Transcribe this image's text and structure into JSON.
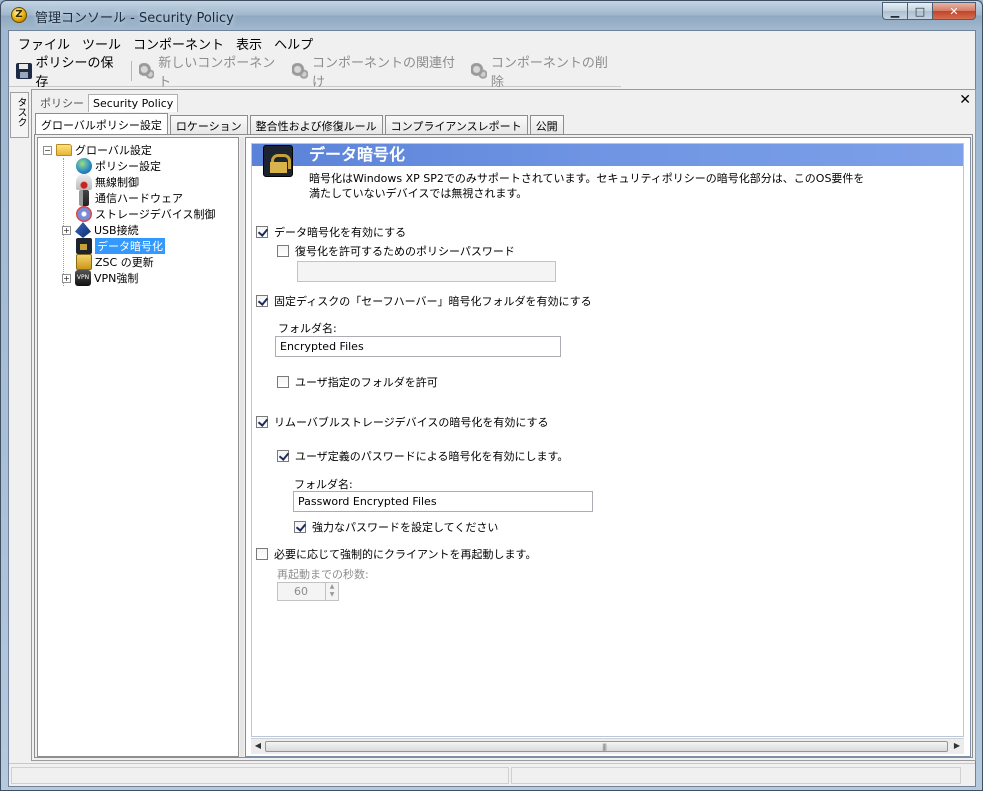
{
  "window": {
    "title": "管理コンソール - Security Policy"
  },
  "menu": [
    "ファイル",
    "ツール",
    "コンポーネント",
    "表示",
    "ヘルプ"
  ],
  "toolbar": {
    "save": "ポリシーの保存",
    "new_component": "新しいコンポーネント",
    "associate_component": "コンポーネントの関連付け",
    "delete_component": "コンポーネントの削除"
  },
  "task_strip": "タスク",
  "document": {
    "label": "ポリシー",
    "tab": "Security Policy"
  },
  "tabs": [
    "グローバルポリシー設定",
    "ロケーション",
    "整合性および修復ルール",
    "コンプライアンスレポート",
    "公開"
  ],
  "tree": {
    "root": "グローバル設定",
    "items": [
      "ポリシー設定",
      "無線制御",
      "通信ハードウェア",
      "ストレージデバイス制御",
      "USB接続",
      "データ暗号化",
      "ZSC の更新",
      "VPN強制"
    ],
    "selected": "データ暗号化"
  },
  "content": {
    "title": "データ暗号化",
    "description": "暗号化はWindows XP SP2でのみサポートされています。セキュリティポリシーの暗号化部分は、このOS要件を満たしていないデバイスでは無視されます。",
    "enable_encryption": {
      "label": "データ暗号化を有効にする",
      "checked": true
    },
    "decrypt_password": {
      "label": "復号化を許可するためのポリシーパスワード",
      "checked": false,
      "value": ""
    },
    "safe_harbor": {
      "label": "固定ディスクの「セーフハーバー」暗号化フォルダを有効にする",
      "checked": true
    },
    "folder_name_label": "フォルダ名:",
    "folder_name_value": "Encrypted Files",
    "user_folder": {
      "label": "ユーザ指定のフォルダを許可",
      "checked": false
    },
    "removable": {
      "label": "リムーバブルストレージデバイスの暗号化を有効にする",
      "checked": true
    },
    "user_password": {
      "label": "ユーザ定義のパスワードによる暗号化を有効にします。",
      "checked": true
    },
    "folder_name_label_2": "フォルダ名:",
    "folder_name_value_2": "Password Encrypted Files",
    "strong_password": {
      "label": "強力なパスワードを設定してください",
      "checked": true
    },
    "force_reboot": {
      "label": "必要に応じて強制的にクライアントを再起動します。",
      "checked": false
    },
    "seconds_label": "再起動までの秒数:",
    "seconds_value": "60"
  },
  "colors": {
    "header_bar": "#5a82d8",
    "selection": "#3399ff"
  }
}
